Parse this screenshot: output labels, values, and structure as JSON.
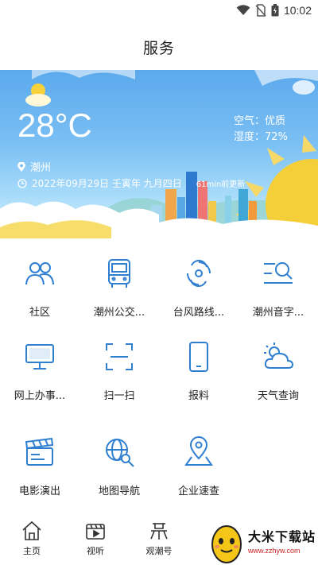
{
  "status_bar": {
    "time": "10:02"
  },
  "header": {
    "title": "服务"
  },
  "weather": {
    "temperature": "28°C",
    "air_quality": "空气：优质",
    "humidity": "湿度：72%",
    "city": "潮州",
    "date": "2022年09月29日  壬寅年  九月四日",
    "updated": "61min前更新"
  },
  "services": [
    {
      "label": "社区",
      "icon": "community-icon"
    },
    {
      "label": "潮州公交...",
      "icon": "bus-icon"
    },
    {
      "label": "台风路线...",
      "icon": "typhoon-icon"
    },
    {
      "label": "潮州音字...",
      "icon": "dictionary-search-icon"
    },
    {
      "label": "网上办事...",
      "icon": "computer-icon"
    },
    {
      "label": "扫一扫",
      "icon": "scan-icon"
    },
    {
      "label": "报料",
      "icon": "tablet-icon"
    },
    {
      "label": "天气查询",
      "icon": "weather-icon"
    },
    {
      "label": "电影演出",
      "icon": "clapperboard-icon"
    },
    {
      "label": "地图导航",
      "icon": "globe-search-icon"
    },
    {
      "label": "企业速查",
      "icon": "location-map-icon"
    }
  ],
  "bottom_nav": [
    {
      "label": "主页",
      "icon": "home-icon"
    },
    {
      "label": "视听",
      "icon": "video-icon"
    },
    {
      "label": "观潮号",
      "icon": "chao-icon"
    }
  ],
  "watermark": {
    "title": "大米下载站",
    "url": "www.zzhyw.com"
  },
  "colors": {
    "icon_blue": "#2f7fd1",
    "sky": "#6cb6f1",
    "sun": "#f7d23c"
  }
}
